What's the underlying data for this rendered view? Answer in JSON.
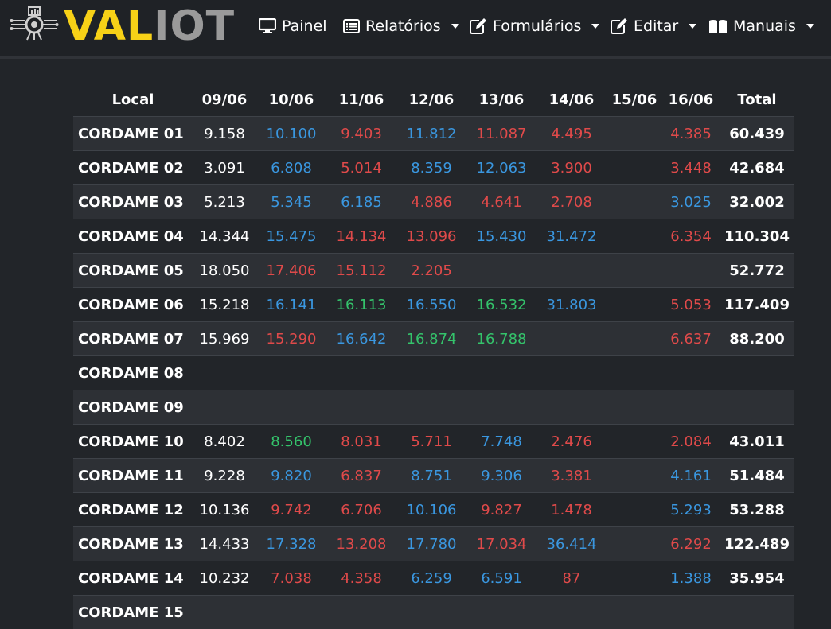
{
  "brand": {
    "part1": "VAL",
    "part2": "IOT"
  },
  "nav": [
    {
      "label": "Painel",
      "icon": "monitor-icon",
      "dropdown": false
    },
    {
      "label": "Relatórios",
      "icon": "list-icon",
      "dropdown": true
    },
    {
      "label": "Formulários",
      "icon": "edit-icon",
      "dropdown": true
    },
    {
      "label": "Editar",
      "icon": "edit-icon",
      "dropdown": true
    },
    {
      "label": "Manuais",
      "icon": "book-icon",
      "dropdown": true
    }
  ],
  "colors": {
    "white": "#ffffff",
    "blue": "#3a97e0",
    "red": "#e04a4a",
    "green": "#34c36b",
    "yellow": "#f7d117"
  },
  "table": {
    "headers": [
      "Local",
      "09/06",
      "10/06",
      "11/06",
      "12/06",
      "13/06",
      "14/06",
      "15/06",
      "16/06",
      "Total"
    ],
    "rows": [
      {
        "local": "CORDAME 01",
        "cells": [
          [
            "9.158",
            "white"
          ],
          [
            "10.100",
            "blue"
          ],
          [
            "9.403",
            "red"
          ],
          [
            "11.812",
            "blue"
          ],
          [
            "11.087",
            "red"
          ],
          [
            "4.495",
            "red"
          ],
          [
            "",
            ""
          ],
          [
            "4.385",
            "red"
          ]
        ],
        "total": "60.439"
      },
      {
        "local": "CORDAME 02",
        "cells": [
          [
            "3.091",
            "white"
          ],
          [
            "6.808",
            "blue"
          ],
          [
            "5.014",
            "red"
          ],
          [
            "8.359",
            "blue"
          ],
          [
            "12.063",
            "blue"
          ],
          [
            "3.900",
            "red"
          ],
          [
            "",
            ""
          ],
          [
            "3.448",
            "red"
          ]
        ],
        "total": "42.684"
      },
      {
        "local": "CORDAME 03",
        "cells": [
          [
            "5.213",
            "white"
          ],
          [
            "5.345",
            "blue"
          ],
          [
            "6.185",
            "blue"
          ],
          [
            "4.886",
            "red"
          ],
          [
            "4.641",
            "red"
          ],
          [
            "2.708",
            "red"
          ],
          [
            "",
            ""
          ],
          [
            "3.025",
            "blue"
          ]
        ],
        "total": "32.002"
      },
      {
        "local": "CORDAME 04",
        "cells": [
          [
            "14.344",
            "white"
          ],
          [
            "15.475",
            "blue"
          ],
          [
            "14.134",
            "red"
          ],
          [
            "13.096",
            "red"
          ],
          [
            "15.430",
            "blue"
          ],
          [
            "31.472",
            "blue"
          ],
          [
            "",
            ""
          ],
          [
            "6.354",
            "red"
          ]
        ],
        "total": "110.304"
      },
      {
        "local": "CORDAME 05",
        "cells": [
          [
            "18.050",
            "white"
          ],
          [
            "17.406",
            "red"
          ],
          [
            "15.112",
            "red"
          ],
          [
            "2.205",
            "red"
          ],
          [
            "",
            ""
          ],
          [
            "",
            ""
          ],
          [
            "",
            ""
          ],
          [
            "",
            ""
          ]
        ],
        "total": "52.772"
      },
      {
        "local": "CORDAME 06",
        "cells": [
          [
            "15.218",
            "white"
          ],
          [
            "16.141",
            "blue"
          ],
          [
            "16.113",
            "green"
          ],
          [
            "16.550",
            "blue"
          ],
          [
            "16.532",
            "green"
          ],
          [
            "31.803",
            "blue"
          ],
          [
            "",
            ""
          ],
          [
            "5.053",
            "red"
          ]
        ],
        "total": "117.409"
      },
      {
        "local": "CORDAME 07",
        "cells": [
          [
            "15.969",
            "white"
          ],
          [
            "15.290",
            "red"
          ],
          [
            "16.642",
            "blue"
          ],
          [
            "16.874",
            "green"
          ],
          [
            "16.788",
            "green"
          ],
          [
            "",
            ""
          ],
          [
            "",
            ""
          ],
          [
            "6.637",
            "red"
          ]
        ],
        "total": "88.200"
      },
      {
        "local": "CORDAME 08",
        "cells": [
          [
            "",
            ""
          ],
          [
            "",
            ""
          ],
          [
            "",
            ""
          ],
          [
            "",
            ""
          ],
          [
            "",
            ""
          ],
          [
            "",
            ""
          ],
          [
            "",
            ""
          ],
          [
            "",
            ""
          ]
        ],
        "total": ""
      },
      {
        "local": "CORDAME 09",
        "cells": [
          [
            "",
            ""
          ],
          [
            "",
            ""
          ],
          [
            "",
            ""
          ],
          [
            "",
            ""
          ],
          [
            "",
            ""
          ],
          [
            "",
            ""
          ],
          [
            "",
            ""
          ],
          [
            "",
            ""
          ]
        ],
        "total": ""
      },
      {
        "local": "CORDAME 10",
        "cells": [
          [
            "8.402",
            "white"
          ],
          [
            "8.560",
            "green"
          ],
          [
            "8.031",
            "red"
          ],
          [
            "5.711",
            "red"
          ],
          [
            "7.748",
            "blue"
          ],
          [
            "2.476",
            "red"
          ],
          [
            "",
            ""
          ],
          [
            "2.084",
            "red"
          ]
        ],
        "total": "43.011"
      },
      {
        "local": "CORDAME 11",
        "cells": [
          [
            "9.228",
            "white"
          ],
          [
            "9.820",
            "blue"
          ],
          [
            "6.837",
            "red"
          ],
          [
            "8.751",
            "blue"
          ],
          [
            "9.306",
            "blue"
          ],
          [
            "3.381",
            "red"
          ],
          [
            "",
            ""
          ],
          [
            "4.161",
            "blue"
          ]
        ],
        "total": "51.484"
      },
      {
        "local": "CORDAME 12",
        "cells": [
          [
            "10.136",
            "white"
          ],
          [
            "9.742",
            "red"
          ],
          [
            "6.706",
            "red"
          ],
          [
            "10.106",
            "blue"
          ],
          [
            "9.827",
            "red"
          ],
          [
            "1.478",
            "red"
          ],
          [
            "",
            ""
          ],
          [
            "5.293",
            "blue"
          ]
        ],
        "total": "53.288"
      },
      {
        "local": "CORDAME 13",
        "cells": [
          [
            "14.433",
            "white"
          ],
          [
            "17.328",
            "blue"
          ],
          [
            "13.208",
            "red"
          ],
          [
            "17.780",
            "blue"
          ],
          [
            "17.034",
            "red"
          ],
          [
            "36.414",
            "blue"
          ],
          [
            "",
            ""
          ],
          [
            "6.292",
            "red"
          ]
        ],
        "total": "122.489"
      },
      {
        "local": "CORDAME 14",
        "cells": [
          [
            "10.232",
            "white"
          ],
          [
            "7.038",
            "red"
          ],
          [
            "4.358",
            "red"
          ],
          [
            "6.259",
            "blue"
          ],
          [
            "6.591",
            "blue"
          ],
          [
            "87",
            "red"
          ],
          [
            "",
            ""
          ],
          [
            "1.388",
            "blue"
          ]
        ],
        "total": "35.954"
      },
      {
        "local": "CORDAME 15",
        "cells": [
          [
            "",
            ""
          ],
          [
            "",
            ""
          ],
          [
            "",
            ""
          ],
          [
            "",
            ""
          ],
          [
            "",
            ""
          ],
          [
            "",
            ""
          ],
          [
            "",
            ""
          ],
          [
            "",
            ""
          ]
        ],
        "total": ""
      }
    ]
  }
}
